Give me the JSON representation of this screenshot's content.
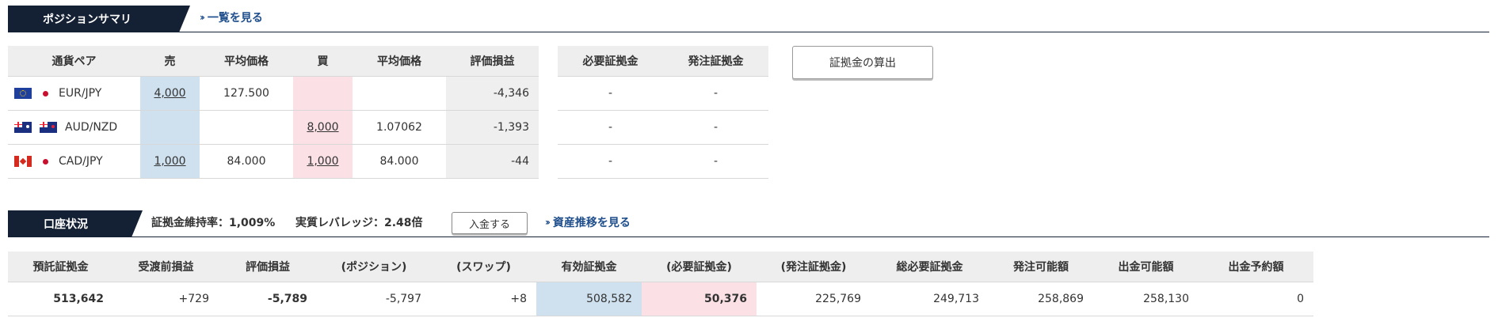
{
  "position_summary": {
    "title": "ポジションサマリ",
    "view_all_link": "一覧を見る",
    "headers": [
      "通貨ペア",
      "売",
      "平均価格",
      "買",
      "平均価格",
      "評価損益"
    ],
    "rows": [
      {
        "flags": [
          "flag-eu-icon",
          "flag-jp-icon"
        ],
        "pair": "EUR/JPY",
        "sell": "4,000",
        "sell_avg": "127.500",
        "buy": "",
        "buy_avg": "",
        "pl": "-4,346"
      },
      {
        "flags": [
          "flag-au-icon",
          "flag-nz-icon"
        ],
        "pair": "AUD/NZD",
        "sell": "",
        "sell_avg": "",
        "buy": "8,000",
        "buy_avg": "1.07062",
        "pl": "-1,393"
      },
      {
        "flags": [
          "flag-ca-icon",
          "flag-jp-icon"
        ],
        "pair": "CAD/JPY",
        "sell": "1,000",
        "sell_avg": "84.000",
        "buy": "1,000",
        "buy_avg": "84.000",
        "pl": "-44"
      }
    ],
    "margin_headers": [
      "必要証拠金",
      "発注証拠金"
    ],
    "margin_rows": [
      [
        "-",
        "-"
      ],
      [
        "-",
        "-"
      ],
      [
        "-",
        "-"
      ]
    ],
    "calc_button": "証拠金の算出"
  },
  "account": {
    "title": "口座状況",
    "maintenance_rate": "証拠金維持率：1,009%",
    "leverage": "実質レバレッジ：2.48倍",
    "deposit_button": "入金する",
    "asset_link": "資産推移を見る",
    "headers": [
      "預託証拠金",
      "受渡前損益",
      "評価損益",
      "(ポジション)",
      "(スワップ)",
      "有効証拠金",
      "(必要証拠金)",
      "(発注証拠金)",
      "総必要証拠金",
      "発注可能額",
      "出金可能額",
      "出金予約額"
    ],
    "values": [
      "513,642",
      "+729",
      "-5,789",
      "-5,797",
      "+8",
      "508,582",
      "50,376",
      "225,769",
      "249,713",
      "258,869",
      "258,130",
      "0"
    ]
  },
  "colors": {
    "header_bar": "#142033",
    "link": "#1f4e8c",
    "sell_highlight": "#cfe1ef",
    "buy_highlight": "#fbe1e5"
  }
}
